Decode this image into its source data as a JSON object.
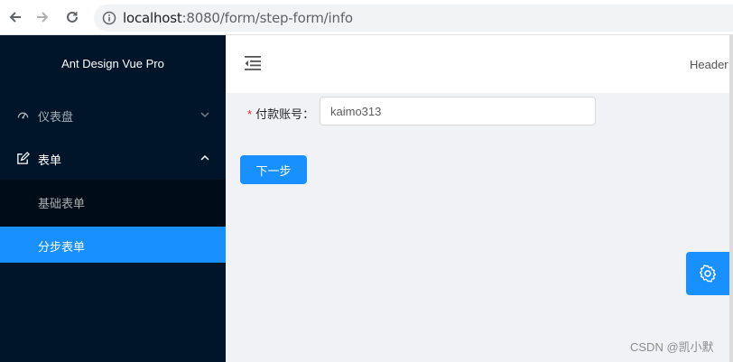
{
  "browser": {
    "url_host": "localhost",
    "url_path": ":8080/form/step-form/info"
  },
  "sider": {
    "logo_text": "Ant Design Vue Pro",
    "menu": {
      "dashboard": {
        "label": "仪表盘",
        "icon": "dashboard-icon"
      },
      "form": {
        "label": "表单",
        "icon": "form-icon"
      },
      "basic_form": {
        "label": "基础表单"
      },
      "step_form": {
        "label": "分步表单"
      }
    }
  },
  "header": {
    "right_text": "Header"
  },
  "form": {
    "account_label": "付款账号：",
    "account_value": "kaimo313",
    "required_mark": "*",
    "next_button": "下一步"
  },
  "watermark": "CSDN @凯小默",
  "colors": {
    "primary": "#1890ff",
    "sider_bg": "#001529",
    "content_bg": "#f0f2f5"
  }
}
